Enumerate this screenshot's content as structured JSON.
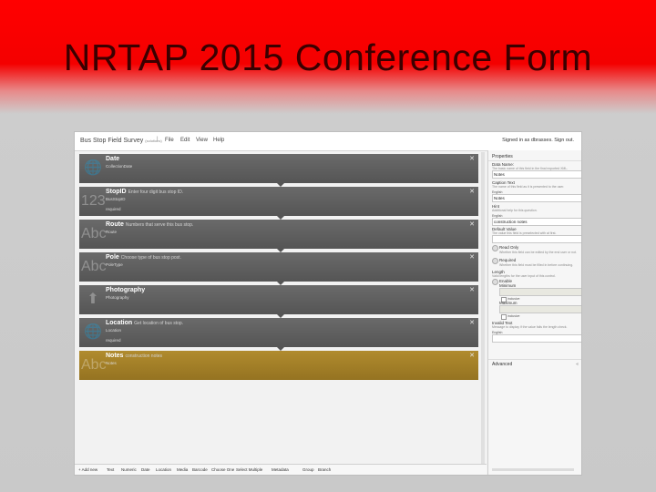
{
  "slide": {
    "title": "NRTAP 2015 Conference Form"
  },
  "app": {
    "title": "Bus Stop Field Survey",
    "title_sub": "(solutions)",
    "menu": [
      "File",
      "Edit",
      "View",
      "Help"
    ],
    "signed_in": "Signed in as dbrasses.",
    "sign_out": "Sign out."
  },
  "fields": [
    {
      "icon": "globe-icon",
      "glyph": "🌐",
      "name": "Date",
      "hint": "",
      "type": "CollectionDate",
      "required": "",
      "selected": false
    },
    {
      "icon": "number-icon",
      "glyph": "123",
      "name": "StopID",
      "hint": "Enter four digit bus stop ID.",
      "type": "BusStopID",
      "required": "required",
      "selected": false
    },
    {
      "icon": "text-icon",
      "glyph": "Abc",
      "name": "Route",
      "hint": "Numbers that serve this bus stop.",
      "type": "Route",
      "required": "",
      "selected": false
    },
    {
      "icon": "text-icon",
      "glyph": "Abc",
      "name": "Pole",
      "hint": "Choose type of bus stop post.",
      "type": "PoleType",
      "required": "",
      "selected": false
    },
    {
      "icon": "photo-icon",
      "glyph": "⬆",
      "name": "Photography",
      "hint": "",
      "type": "Photography",
      "required": "",
      "selected": false
    },
    {
      "icon": "globe-icon",
      "glyph": "🌐",
      "name": "Location",
      "hint": "Get location of bus stop.",
      "type": "Location",
      "required": "required",
      "selected": false
    },
    {
      "icon": "text-icon",
      "glyph": "Abc",
      "name": "Notes",
      "hint": "construction notes",
      "type": "Notes",
      "required": "",
      "selected": true
    }
  ],
  "toolbar": {
    "add_new": "+ Add new",
    "types": [
      "Text",
      "Numeric",
      "Date",
      "Location",
      "Media",
      "Barcode",
      "Choose One",
      "Select Multiple",
      "Metadata",
      "Group",
      "Branch"
    ]
  },
  "properties": {
    "header": "Properties",
    "data_name_label": "Data Name:",
    "data_name_help": "The basic name of this field in the final exported XML.",
    "data_name_value": "Notes",
    "caption_label": "Caption Text",
    "caption_help": "The name of this field as it is presented to the user.",
    "caption_lang": "English",
    "caption_value": "Notes",
    "hint_label": "Hint",
    "hint_help": "Additional help for this question.",
    "hint_lang": "English",
    "hint_value": "construction notes",
    "default_label": "Default Value",
    "default_help": "The value this field is preselected with at first.",
    "default_value": "",
    "readonly_label": "Read Only",
    "readonly_help": "Whether this field can be edited by the end user or not.",
    "required_label": "Required",
    "required_help": "Whether this field must be filled in before continuing.",
    "length_label": "Length",
    "length_help": "Valid lengths for the user input of this control.",
    "enable_label": "Enable",
    "minimum_label": "Minimum",
    "inclusive_label": "inclusive",
    "maximum_label": "Maximum",
    "inclusive2_label": "inclusive",
    "invalid_label": "Invalid Text",
    "invalid_help": "Message to display if the value fails the length check.",
    "invalid_lang": "English",
    "advanced_label": "Advanced",
    "advanced_chevron": "«"
  },
  "colors": {
    "title_bar_top": "#ff0000",
    "field_bg": "#5f5f5f",
    "field_selected_bg": "#a5832a"
  }
}
